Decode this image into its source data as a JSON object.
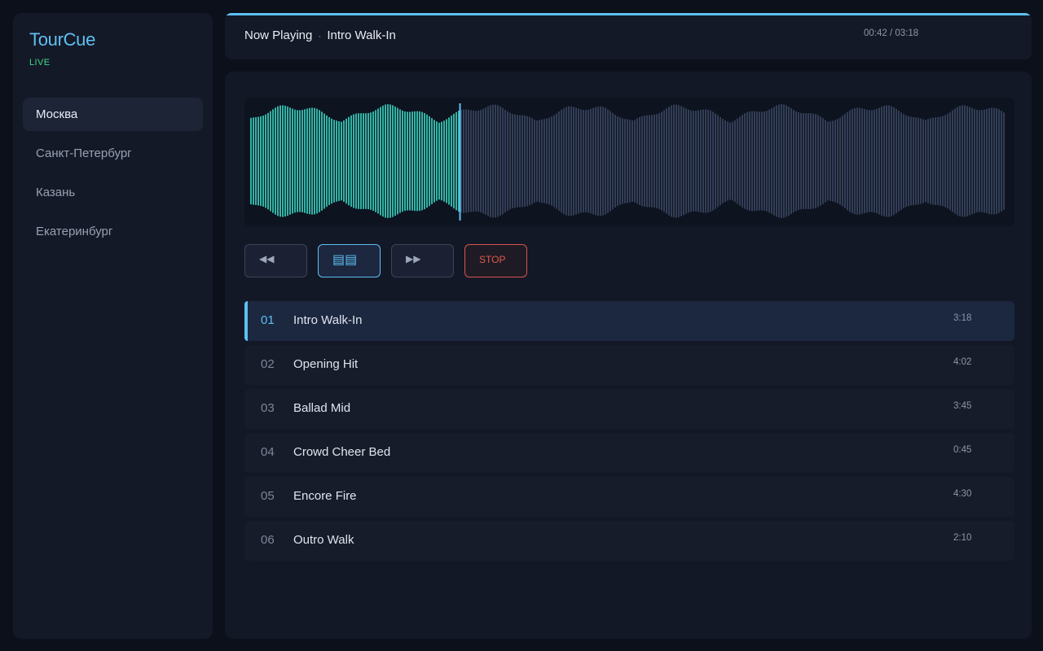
{
  "app": {
    "brand": "TourCue",
    "status": "LIVE",
    "accent": "#5ec0f2",
    "played_color": "#3ddcc7",
    "unplayed_color": "#3b4a64",
    "status_color": "#3fd98a"
  },
  "sidebar": {
    "items": [
      {
        "label": "Москва",
        "active": true
      },
      {
        "label": "Санкт-Петербург",
        "active": false
      },
      {
        "label": "Казань",
        "active": false
      },
      {
        "label": "Екатеринбург",
        "active": false
      }
    ]
  },
  "now_playing": {
    "prefix": "Now Playing",
    "separator": "·",
    "title": "Intro Walk-In",
    "time": "00:42 / 03:18",
    "progress": 1.0
  },
  "waveform": {
    "playhead_fraction": 0.277
  },
  "controls": {
    "prev_label": "◀◀",
    "prev_icon": "rewind-icon",
    "queue_label": "▤▤",
    "queue_icon": "list-icon",
    "next_label": "▶▶",
    "next_icon": "fast-forward-icon",
    "stop_label": "STOP"
  },
  "tracks": [
    {
      "num": "01",
      "title": "Intro Walk-In",
      "duration": "3:18",
      "active": true
    },
    {
      "num": "02",
      "title": "Opening Hit",
      "duration": "4:02",
      "active": false
    },
    {
      "num": "03",
      "title": "Ballad Mid",
      "duration": "3:45",
      "active": false
    },
    {
      "num": "04",
      "title": "Crowd Cheer Bed",
      "duration": "0:45",
      "active": false
    },
    {
      "num": "05",
      "title": "Encore Fire",
      "duration": "4:30",
      "active": false
    },
    {
      "num": "06",
      "title": "Outro Walk",
      "duration": "2:10",
      "active": false
    }
  ]
}
